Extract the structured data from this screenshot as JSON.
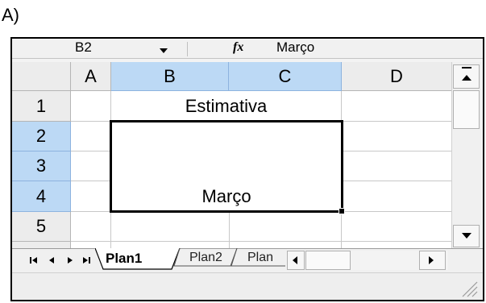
{
  "question_label": "A)",
  "formula_bar": {
    "name_box": "B2",
    "fx_symbol": "fx",
    "content": "Março"
  },
  "sheet": {
    "columns": [
      "A",
      "B",
      "C",
      "D"
    ],
    "rows": [
      "1",
      "2",
      "3",
      "4",
      "5"
    ],
    "selected_range": "B2:C4",
    "cells": {
      "B1_C1": "Estimativa",
      "B4_C4": "Março"
    }
  },
  "sheet_tabs": {
    "nav": [
      "first-sheet",
      "prev-sheet",
      "next-sheet",
      "last-sheet"
    ],
    "tabs": [
      "Plan1",
      "Plan2",
      "Plan"
    ],
    "active": "Plan1"
  },
  "colors": {
    "header_bg": "#ececec",
    "selected_header_bg": "#bcd9f5",
    "gridline": "#c8c8c8",
    "selection_border": "#000000"
  }
}
